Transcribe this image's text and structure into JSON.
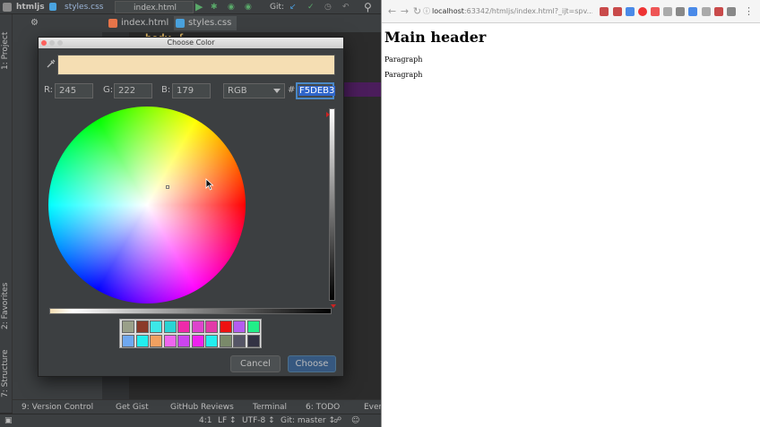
{
  "ide": {
    "project_name": "htmljs",
    "toolbar_file_tab": "styles.css",
    "run_config": "index.html",
    "git_label": "Git:",
    "editor_tabs": [
      {
        "label": "index.html",
        "color": "#e8754a"
      },
      {
        "label": "styles.css",
        "color": "#4aa3df"
      }
    ],
    "code_line": "body {",
    "left_labels": {
      "project": "1: Project",
      "favorites": "2: Favorites",
      "structure": "7: Structure"
    },
    "bottom_tools": [
      "9: Version Control",
      "Get Gist",
      "GitHub Reviews",
      "Terminal",
      "6: TODO",
      "Even"
    ],
    "status": {
      "position": "4:1",
      "line_sep": "LF ↕",
      "encoding": "UTF-8 ↕",
      "git": "Git: master ↕"
    }
  },
  "dialog": {
    "title": "Choose Color",
    "preview_color": "#F5DEB3",
    "r_label": "R:",
    "r_value": "245",
    "g_label": "G:",
    "g_value": "222",
    "b_label": "B:",
    "b_value": "179",
    "mode": "RGB",
    "hash": "#",
    "hex": "F5DEB3",
    "swatches": [
      "#9aa08a",
      "#8b3a2a",
      "#3de8e8",
      "#2ad4d4",
      "#ee2aaa",
      "#dd44cc",
      "#e23aa8",
      "#ee1111",
      "#b45cf0",
      "#22ee88",
      "#6fa8f0",
      "#22eeee",
      "#f0a060",
      "#ee66ee",
      "#cc44ee",
      "#ee22ee",
      "#22eeee",
      "#7a8a6a",
      "#555566",
      "#333344"
    ],
    "cancel_label": "Cancel",
    "choose_label": "Choose"
  },
  "browser": {
    "url_host": "localhost",
    "url_rest": ":63342/htmljs/index.html?_ijt=spv...",
    "heading": "Main header",
    "paragraphs": [
      "Paragraph",
      "Paragraph"
    ]
  }
}
